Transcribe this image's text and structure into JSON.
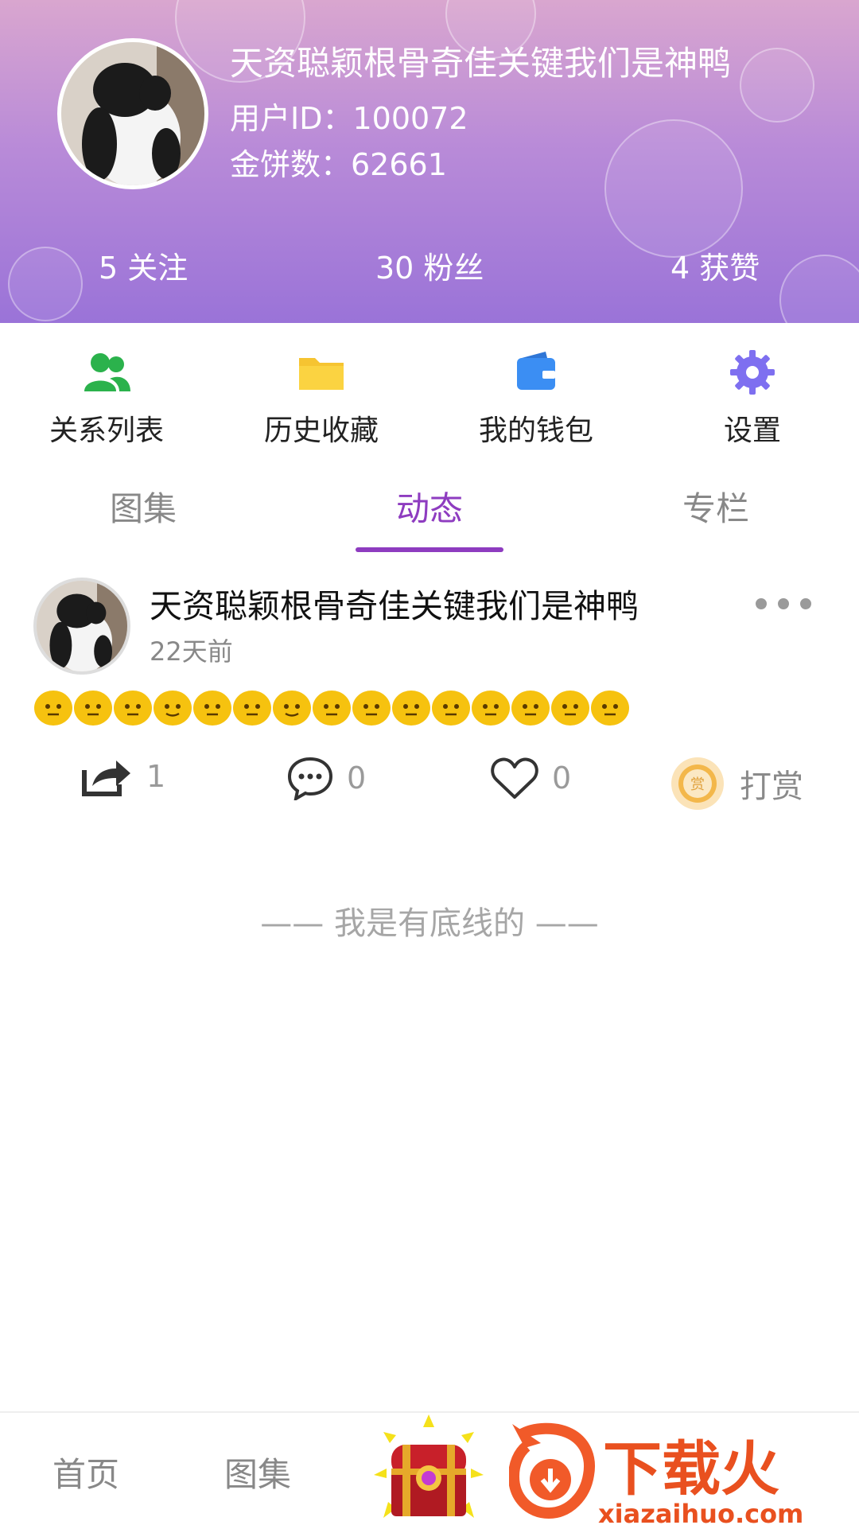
{
  "profile": {
    "username": "天资聪颖根骨奇佳关键我们是神鸭",
    "user_id": "用户ID：100072",
    "coins": "金饼数：62661",
    "stats": {
      "follow": "5 关注",
      "fans": "30 粉丝",
      "likes": "4 获赞"
    }
  },
  "quick_menu": [
    {
      "label": "关系列表",
      "icon": "users-icon",
      "color": "#2bb24c"
    },
    {
      "label": "历史收藏",
      "icon": "folder-icon",
      "color": "#f6c431"
    },
    {
      "label": "我的钱包",
      "icon": "wallet-icon",
      "color": "#3b8ef3"
    },
    {
      "label": "设置",
      "icon": "gear-icon",
      "color": "#7e6ff0"
    }
  ],
  "tabs": {
    "items": [
      "图集",
      "动态",
      "专栏"
    ],
    "active_index": 1,
    "active_color": "#8e3cc0"
  },
  "post": {
    "author": "天资聪颖根骨奇佳关键我们是神鸭",
    "time": "22天前",
    "emoji_count": 15,
    "actions": {
      "share_count": "1",
      "comment_count": "0",
      "like_count": "0",
      "reward_label": "打赏",
      "reward_badge": "赏"
    }
  },
  "bottom_line": "—— 我是有底线的 ——",
  "bottom_nav": {
    "home": "首页",
    "album": "图集"
  },
  "watermark": {
    "brand": "下载火",
    "url": "xiazaihuo.com"
  }
}
